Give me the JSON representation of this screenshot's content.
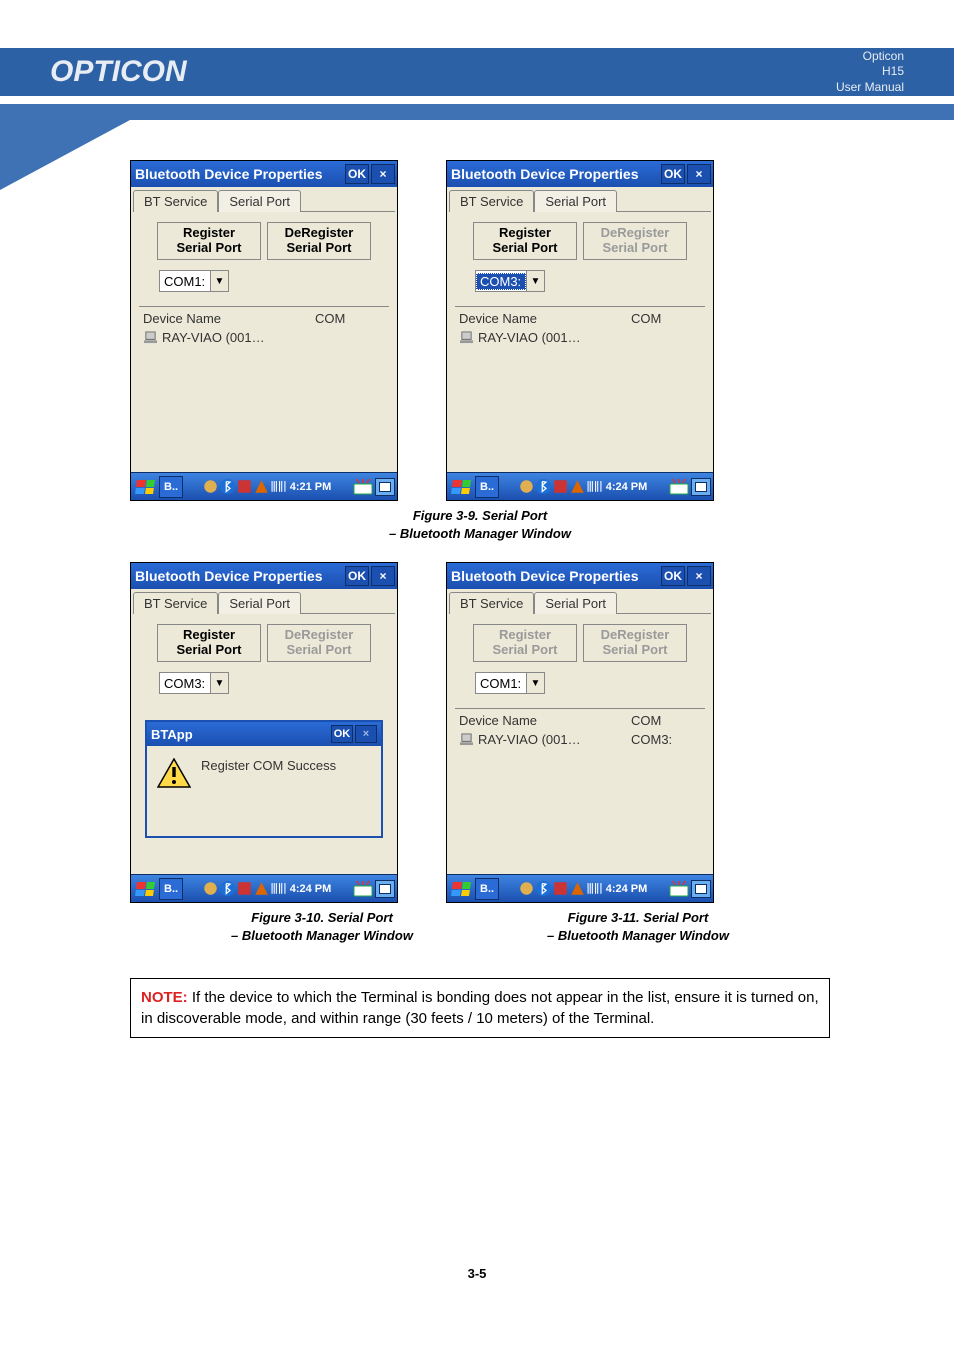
{
  "header": {
    "logo": "OPTICON",
    "doc_line1": "Opticon",
    "doc_line2": "H15",
    "doc_line3": "User Manual"
  },
  "bt_windows": {
    "title": "Bluetooth Device Properties",
    "ok": "OK",
    "close": "×",
    "tabs": {
      "bt_service": "BT Service",
      "serial_port": "Serial Port"
    },
    "buttons": {
      "register": "Register\nSerial Port",
      "deregister": "DeRegister\nSerial Port"
    },
    "panel": {
      "head_device": "Device Name",
      "head_com": "COM",
      "row_device": "RAY-VIAO (001…"
    }
  },
  "ss": {
    "s1": {
      "combo": "COM1:",
      "time": "4:21 PM"
    },
    "s2": {
      "combo": "COM3:",
      "time": "4:24 PM"
    },
    "s3": {
      "combo": "COM3:",
      "time": "4:24 PM"
    },
    "s4": {
      "combo": "COM1:",
      "com_assigned": "COM3:",
      "time": "4:24 PM"
    }
  },
  "msgbox": {
    "title": "BTApp",
    "ok": "OK",
    "close": "×",
    "text": "Register COM Success"
  },
  "taskbar": {
    "app": "B.."
  },
  "captions": {
    "c1a": "Figure 3-9. Serial Port",
    "c1b": "– Bluetooth Manager Window",
    "c2a": "Figure 3-10. Serial Port",
    "c2b": "– Bluetooth Manager Window",
    "c3a": "Figure 3-11. Serial Port",
    "c3b": "– Bluetooth Manager Window"
  },
  "note": {
    "label": "NOTE:",
    "text": "If the device to which the Terminal is bonding does not appear in the list, ensure it is turned on, in discoverable mode, and within range (30 feets / 10 meters) of the Terminal."
  },
  "page_number": "3-5"
}
